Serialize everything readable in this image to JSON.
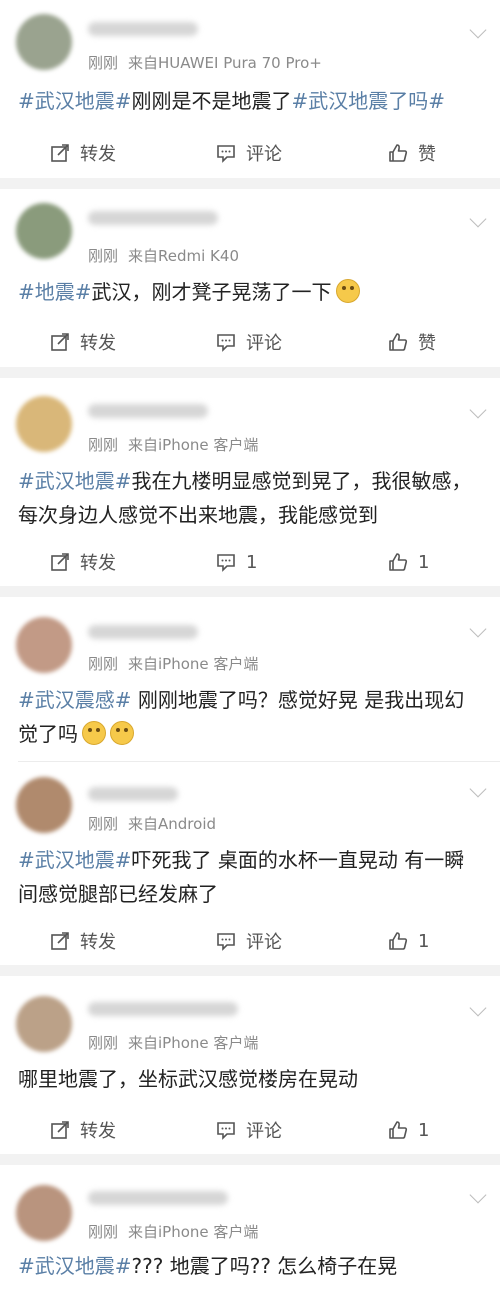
{
  "posts": [
    {
      "meta_time": "刚刚",
      "meta_source": "来自HUAWEI Pura 70 Pro+",
      "segments": [
        "#武汉地震#",
        "刚刚是不是地震了",
        "#武汉地震了吗#"
      ],
      "avatar_color": "#9aa38f",
      "actions": {
        "repost": "转发",
        "comment": "评论",
        "like": "赞"
      }
    },
    {
      "meta_time": "刚刚",
      "meta_source": "来自Redmi K40",
      "segments": [
        "#地震#",
        "武汉，刚才凳子晃荡了一下"
      ],
      "avatar_color": "#8a9b7c",
      "actions": {
        "repost": "转发",
        "comment": "评论",
        "like": "赞"
      }
    },
    {
      "meta_time": "刚刚",
      "meta_source": "来自iPhone 客户端",
      "segments": [
        "#武汉地震#",
        "我在九楼明显感觉到晃了，我很敏感，每次身边人感觉不出来地震，我能感觉到"
      ],
      "avatar_color": "#d9b779",
      "actions": {
        "repost": "转发",
        "comment": "1",
        "like": "1"
      }
    },
    {
      "meta_time": "刚刚",
      "meta_source": "来自iPhone 客户端",
      "segments": [
        "#武汉震感#",
        " 刚刚地震了吗？感觉好晃 是我出现幻觉了吗"
      ],
      "avatar_color": "#c29a86"
    },
    {
      "meta_time": "刚刚",
      "meta_source": "来自Android",
      "segments": [
        "#武汉地震#",
        "吓死我了 桌面的水杯一直晃动 有一瞬间感觉腿部已经发麻了"
      ],
      "avatar_color": "#b08a6d",
      "actions": {
        "repost": "转发",
        "comment": "评论",
        "like": "1"
      }
    },
    {
      "meta_time": "刚刚",
      "meta_source": "来自iPhone 客户端",
      "segments": [
        "哪里地震了，坐标武汉感觉楼房在晃动"
      ],
      "avatar_color": "#bba188",
      "actions": {
        "repost": "转发",
        "comment": "评论",
        "like": "1"
      }
    },
    {
      "meta_time": "刚刚",
      "meta_source": "来自iPhone 客户端",
      "segments": [
        "#武汉地震#",
        "??? 地震了吗?? 怎么椅子在晃"
      ],
      "avatar_color": "#b9947e"
    }
  ],
  "colors": {
    "hashtag": "#5a7fa6",
    "text": "#222222",
    "meta": "#8a8a8a",
    "separator": "#f2f2f2"
  },
  "icons": {
    "repost": "repost-icon",
    "comment": "comment-icon",
    "like": "like-icon",
    "menu": "chevron-down-icon",
    "emoji_shocked": "shocked-emoji-icon",
    "emoji_laugh": "laugh-cry-emoji-icon"
  }
}
